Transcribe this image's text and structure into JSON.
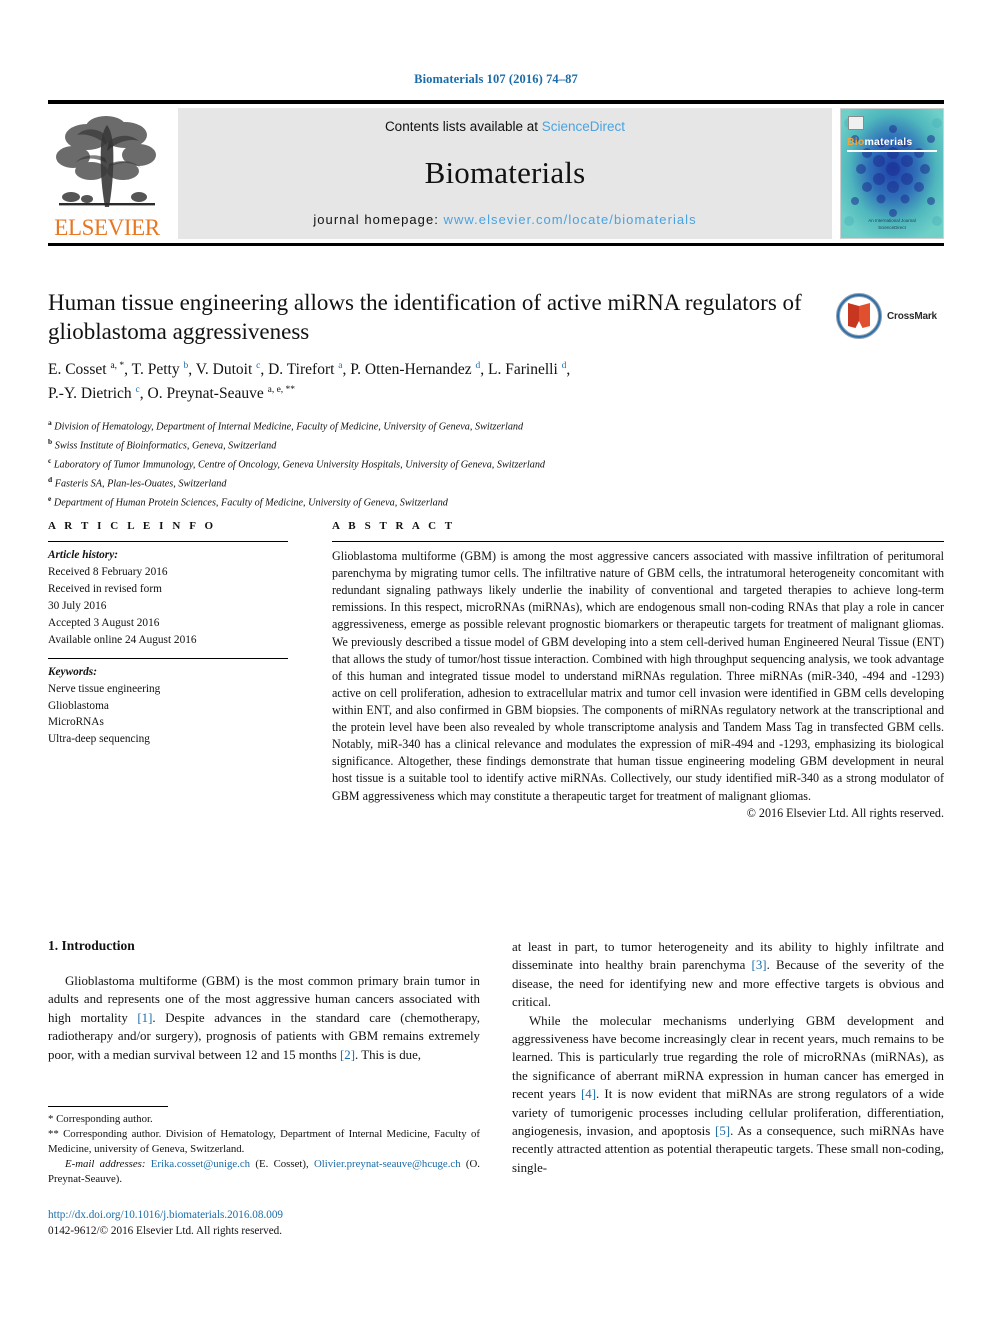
{
  "running_head": "Biomaterials 107 (2016) 74–87",
  "masthead": {
    "contents_prefix": "Contents lists available at ",
    "sciencedirect": "ScienceDirect",
    "journal_name": "Biomaterials",
    "homepage_prefix": "journal homepage: ",
    "homepage_url": "www.elsevier.com/locate/biomaterials",
    "publisher": "ELSEVIER",
    "cover": {
      "title_b": "Bio",
      "title_rest": "materials",
      "footer_line1": "An International Journal",
      "footer_line2": "ScienceDirect"
    }
  },
  "article": {
    "title": "Human tissue engineering allows the identification of active miRNA regulators of glioblastoma aggressiveness",
    "crossmark_label": "CrossMark",
    "authors_line1_parts": [
      {
        "name": "E. Cosset ",
        "sup": "a, *",
        "sep": ", "
      },
      {
        "name": "T. Petty ",
        "sup": "b",
        "sep": ", "
      },
      {
        "name": "V. Dutoit ",
        "sup": "c",
        "sep": ", "
      },
      {
        "name": "D. Tirefort ",
        "sup": "a",
        "sep": ", "
      },
      {
        "name": "P. Otten-Hernandez ",
        "sup": "d",
        "sep": ", "
      },
      {
        "name": "L. Farinelli ",
        "sup": "d",
        "sep": ","
      }
    ],
    "authors_line2_parts": [
      {
        "name": "P.-Y. Dietrich ",
        "sup": "c",
        "sep": ", "
      },
      {
        "name": "O. Preynat-Seauve ",
        "sup": "a, e, **",
        "sep": ""
      }
    ],
    "affiliations": [
      {
        "mark": "a",
        "text": "Division of Hematology, Department of Internal Medicine, Faculty of Medicine, University of Geneva, Switzerland"
      },
      {
        "mark": "b",
        "text": "Swiss Institute of Bioinformatics, Geneva, Switzerland"
      },
      {
        "mark": "c",
        "text": "Laboratory of Tumor Immunology, Centre of Oncology, Geneva University Hospitals, University of Geneva, Switzerland"
      },
      {
        "mark": "d",
        "text": "Fasteris SA, Plan-les-Ouates, Switzerland"
      },
      {
        "mark": "e",
        "text": "Department of Human Protein Sciences, Faculty of Medicine, University of Geneva, Switzerland"
      }
    ]
  },
  "article_info": {
    "heading": "A R T I C L E  I N F O",
    "history_label": "Article history:",
    "history": [
      "Received 8 February 2016",
      "Received in revised form",
      "30 July 2016",
      "Accepted 3 August 2016",
      "Available online 24 August 2016"
    ],
    "keywords_label": "Keywords:",
    "keywords": [
      "Nerve tissue engineering",
      "Glioblastoma",
      "MicroRNAs",
      "Ultra-deep sequencing"
    ]
  },
  "abstract": {
    "heading": "A B S T R A C T",
    "text": "Glioblastoma multiforme (GBM) is among the most aggressive cancers associated with massive infiltration of peritumoral parenchyma by migrating tumor cells. The infiltrative nature of GBM cells, the intratumoral heterogeneity concomitant with redundant signaling pathways likely underlie the inability of conventional and targeted therapies to achieve long-term remissions. In this respect, microRNAs (miRNAs), which are endogenous small non-coding RNAs that play a role in cancer aggressiveness, emerge as possible relevant prognostic biomarkers or therapeutic targets for treatment of malignant gliomas. We previously described a tissue model of GBM developing into a stem cell-derived human Engineered Neural Tissue (ENT) that allows the study of tumor/host tissue interaction. Combined with high throughput sequencing analysis, we took advantage of this human and integrated tissue model to understand miRNAs regulation. Three miRNAs (miR-340, -494 and -1293) active on cell proliferation, adhesion to extracellular matrix and tumor cell invasion were identified in GBM cells developing within ENT, and also confirmed in GBM biopsies. The components of miRNAs regulatory network at the transcriptional and the protein level have been also revealed by whole transcriptome analysis and Tandem Mass Tag in transfected GBM cells. Notably, miR-340 has a clinical relevance and modulates the expression of miR-494 and -1293, emphasizing its biological significance. Altogether, these findings demonstrate that human tissue engineering modeling GBM development in neural host tissue is a suitable tool to identify active miRNAs. Collectively, our study identified miR-340 as a strong modulator of GBM aggressiveness which may constitute a therapeutic target for treatment of malignant gliomas.",
    "copyright": "© 2016 Elsevier Ltd. All rights reserved."
  },
  "introduction": {
    "heading": "1. Introduction",
    "left_paragraph_1_a": "Glioblastoma multiforme (GBM) is the most common primary brain tumor in adults and represents one of the most aggressive human cancers associated with high mortality ",
    "ref1": "[1]",
    "left_paragraph_1_b": ". Despite advances in the standard care (chemotherapy, radiotherapy and/or surgery), prognosis of patients with GBM remains extremely poor, with a median survival between 12 and 15 months ",
    "ref2": "[2]",
    "left_paragraph_1_c": ". This is due,",
    "right_paragraph_1_a": "at least in part, to tumor heterogeneity and its ability to highly infiltrate and disseminate into healthy brain parenchyma ",
    "ref3": "[3]",
    "right_paragraph_1_b": ". Because of the severity of the disease, the need for identifying new and more effective targets is obvious and critical.",
    "right_paragraph_2_a": "While the molecular mechanisms underlying GBM development and aggressiveness have become increasingly clear in recent years, much remains to be learned. This is particularly true regarding the role of microRNAs (miRNAs), as the significance of aberrant miRNA expression in human cancer has emerged in recent years ",
    "ref4": "[4]",
    "right_paragraph_2_b": ". It is now evident that miRNAs are strong regulators of a wide variety of tumorigenic processes including cellular proliferation, differentiation, angiogenesis, invasion, and apoptosis ",
    "ref5": "[5]",
    "right_paragraph_2_c": ". As a consequence, such miRNAs have recently attracted attention as potential therapeutic targets. These small non-coding, single-"
  },
  "footnotes": {
    "corr1_mark": "*",
    "corr1_text": "Corresponding author.",
    "corr2_mark": "**",
    "corr2_text": "Corresponding author. Division of Hematology, Department of Internal Medicine, Faculty of Medicine, university of Geneva, Switzerland.",
    "email_label": "E-mail addresses:",
    "email1": "Erika.cosset@unige.ch",
    "email1_owner": " (E. Cosset), ",
    "email2": "Olivier.preynat-seauve@hcuge.ch",
    "email2_owner": " (O. Preynat-Seauve)."
  },
  "footer": {
    "doi": "http://dx.doi.org/10.1016/j.biomaterials.2016.08.009",
    "issn": "0142-9612/© 2016 Elsevier Ltd. All rights reserved."
  },
  "colors": {
    "link": "#1b6ca8",
    "sciencedirect": "#4aa3df",
    "elsevier_orange": "#e87722",
    "cover_teal": "#49b2b8"
  }
}
